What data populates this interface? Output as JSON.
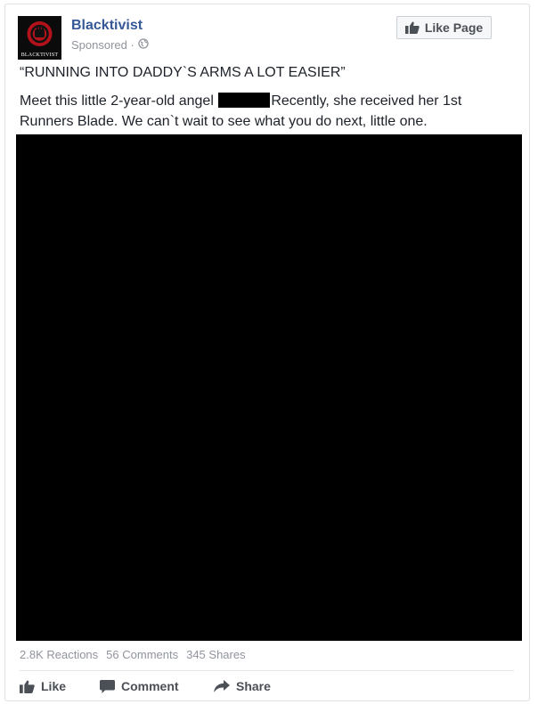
{
  "post": {
    "page_name": "Blacktivist",
    "avatar_caption": "BLACKTIVIST",
    "sponsored": "Sponsored ·",
    "like_page_label": "Like Page",
    "headline": "“RUNNING INTO DADDY`S ARMS A LOT EASIER”",
    "body_part1": "Meet this little 2-year-old angel",
    "body_part2": "Recently, she received her 1st Runners Blade. We can`t wait to see what you do next, little one."
  },
  "stats": {
    "reactions": "2.8K Reactions",
    "comments": "56 Comments",
    "shares": "345 Shares"
  },
  "actions": {
    "like": "Like",
    "comment": "Comment",
    "share": "Share"
  },
  "colors": {
    "page_name": "#365899",
    "muted": "#90949c",
    "action_text": "#4b4f56"
  },
  "icons": {
    "like_page": "thumbs-up-icon",
    "globe": "globe-icon",
    "like": "thumbs-up-icon",
    "comment": "speech-bubble-icon",
    "share": "share-arrow-icon"
  }
}
